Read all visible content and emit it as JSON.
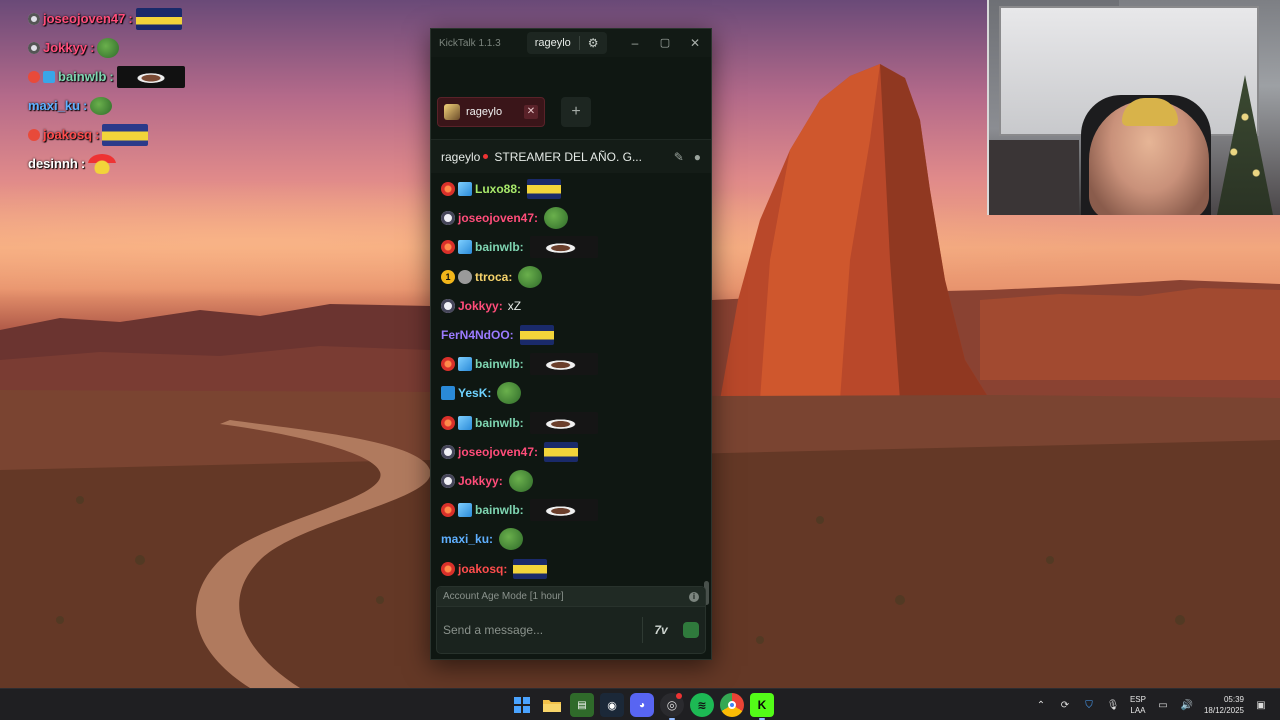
{
  "window": {
    "app_title": "KickTalk 1.1.3",
    "title_user": "rageylo"
  },
  "tabs": [
    {
      "label": "rageylo"
    }
  ],
  "channel": {
    "name": "rageylo",
    "stream_title": "STREAMER DEL AÑO. G..."
  },
  "messages": [
    {
      "user": "Luxo88",
      "color": "#a7e86a",
      "badges": [
        "gift-badge",
        "cube-badge"
      ],
      "text": "",
      "emote": "bus-emote"
    },
    {
      "user": "joseojoven47",
      "color": "#ff4d7a",
      "badges": [
        "circle-badge"
      ],
      "text": "",
      "emote": "pepe-emote"
    },
    {
      "user": "bainwlb",
      "color": "#7fd6b2",
      "badges": [
        "gift-badge",
        "cube-badge"
      ],
      "text": "",
      "emote": "face-emote"
    },
    {
      "user": "ttroca",
      "color": "#f6d36b",
      "badges": [
        "sub-1-badge",
        "gray-badge"
      ],
      "text": "",
      "emote": "pepe-emote"
    },
    {
      "user": "Jokkyy",
      "color": "#ff4d7a",
      "badges": [
        "circle-badge"
      ],
      "text": "xZ",
      "emote": ""
    },
    {
      "user": "FerN4NdOO",
      "color": "#9b7bff",
      "badges": [],
      "text": "",
      "emote": "bus-emote"
    },
    {
      "user": "bainwlb",
      "color": "#7fd6b2",
      "badges": [
        "gift-badge",
        "cube-badge"
      ],
      "text": "",
      "emote": "face-emote"
    },
    {
      "user": "YesK",
      "color": "#6fd3ff",
      "badges": [
        "mod-badge"
      ],
      "text": "",
      "emote": "pepe-emote"
    },
    {
      "user": "bainwlb",
      "color": "#7fd6b2",
      "badges": [
        "gift-badge",
        "cube-badge"
      ],
      "text": "",
      "emote": "face-emote"
    },
    {
      "user": "joseojoven47",
      "color": "#ff4d7a",
      "badges": [
        "circle-badge"
      ],
      "text": "",
      "emote": "bus-emote"
    },
    {
      "user": "Jokkyy",
      "color": "#ff4d7a",
      "badges": [
        "circle-badge"
      ],
      "text": "",
      "emote": "pepe-emote"
    },
    {
      "user": "bainwlb",
      "color": "#7fd6b2",
      "badges": [
        "gift-badge",
        "cube-badge"
      ],
      "text": "",
      "emote": "face-emote"
    },
    {
      "user": "maxi_ku",
      "color": "#5fb0ff",
      "badges": [],
      "text": "",
      "emote": "pepe-emote"
    },
    {
      "user": "joakosq",
      "color": "#ff4d4d",
      "badges": [
        "gift-badge"
      ],
      "text": "",
      "emote": "bus-emote"
    },
    {
      "user": "desinnh",
      "color": "#ffffff",
      "badges": [],
      "text": "",
      "emote": "santa-emote"
    }
  ],
  "composer": {
    "mode_label": "Account Age Mode [1 hour]",
    "placeholder": "Send a message...",
    "seventv_label": "7v"
  },
  "overlay": [
    {
      "user": "joseojoven47",
      "color": "#ff4d7a"
    },
    {
      "user": "Jokkyy",
      "color": "#ff4d7a"
    },
    {
      "user": "bainwlb",
      "color": "#7fd6b2"
    },
    {
      "user": "maxi_ku",
      "color": "#5fb0ff"
    },
    {
      "user": "joakosq",
      "color": "#ff4d4d"
    },
    {
      "user": "desinnh",
      "color": "#ffffff"
    }
  ],
  "taskbar": {
    "lang_top": "ESP",
    "lang_bottom": "LAA",
    "time": "05:39",
    "date": "18/12/2025"
  },
  "colors": {
    "accent": "#53fc18",
    "tab_bg": "#3a1519",
    "window_bg": "#0f1712"
  }
}
